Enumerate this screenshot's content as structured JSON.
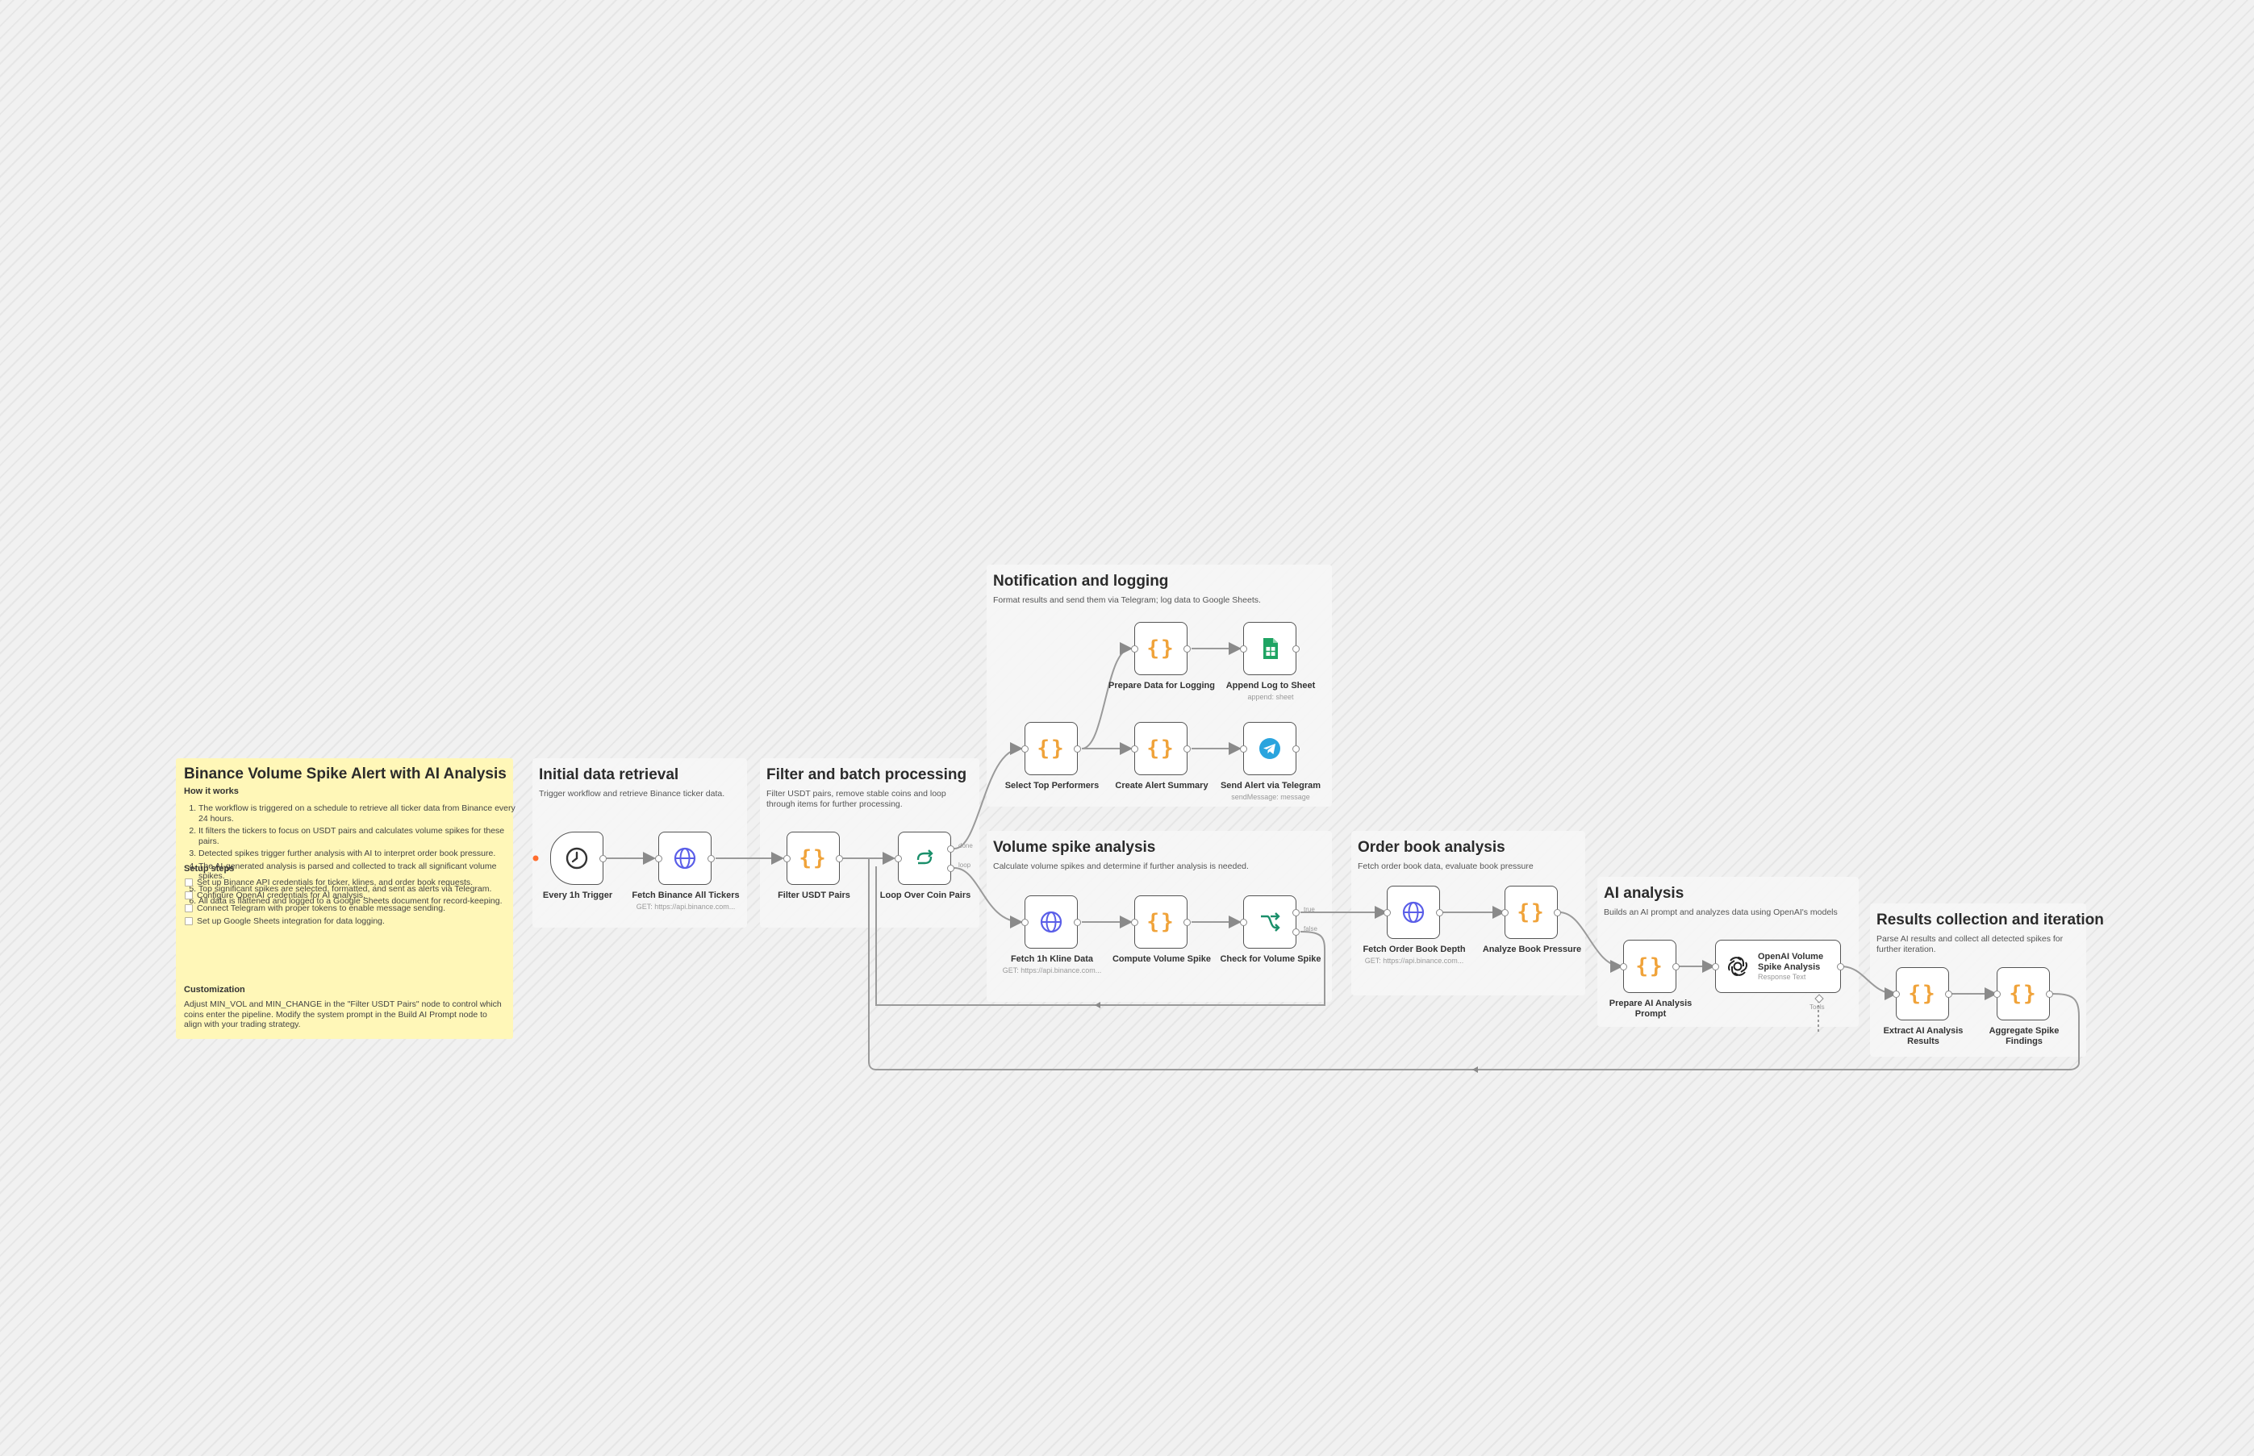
{
  "overview": {
    "title": "Binance Volume Spike Alert with AI Analysis",
    "how_heading": "How it works",
    "steps": [
      "The workflow is triggered on a schedule to retrieve all ticker data from Binance every 24 hours.",
      "It filters the tickers to focus on USDT pairs and calculates volume spikes for these pairs.",
      "Detected spikes trigger further analysis with AI to interpret order book pressure.",
      "The AI-generated analysis is parsed and collected to track all significant volume spikes.",
      "Top significant spikes are selected, formatted, and sent as alerts via Telegram.",
      "All data is flattened and logged to a Google Sheets document for record-keeping."
    ],
    "setup_heading": "Setup steps",
    "setup_steps": [
      "Set up Binance API credentials for ticker, klines, and order book requests.",
      "Configure OpenAI credentials for AI analysis.",
      "Connect Telegram with proper tokens to enable message sending.",
      "Set up Google Sheets integration for data logging."
    ],
    "custom_heading": "Customization",
    "custom_text": "Adjust MIN_VOL and MIN_CHANGE in the \"Filter USDT Pairs\" node to control which coins enter the pipeline. Modify the system prompt in the Build AI Prompt node to align with your trading strategy."
  },
  "sections": {
    "initial": {
      "title": "Initial data retrieval",
      "desc": "Trigger workflow and retrieve Binance ticker data."
    },
    "filter": {
      "title": "Filter and batch processing",
      "desc": "Filter USDT pairs, remove stable coins and loop through items for further processing."
    },
    "notify": {
      "title": "Notification and logging",
      "desc": "Format results and send them via Telegram; log data to Google Sheets."
    },
    "volume": {
      "title": "Volume spike analysis",
      "desc": "Calculate volume spikes and determine if further analysis is needed."
    },
    "orderbook": {
      "title": "Order book analysis",
      "desc": "Fetch order book data, evaluate book pressure"
    },
    "ai": {
      "title": "AI analysis",
      "desc": "Builds an AI prompt and analyzes data using OpenAI's models"
    },
    "results": {
      "title": "Results collection and iteration",
      "desc": "Parse AI results and collect all detected spikes for further iteration."
    }
  },
  "nodes": {
    "trigger": {
      "label": "Every 1h Trigger",
      "icon": "clock-icon"
    },
    "fetch_tickers": {
      "label": "Fetch Binance All Tickers",
      "sub": "GET: https://api.binance.com...",
      "icon": "globe-icon"
    },
    "filter_usdt": {
      "label": "Filter USDT Pairs",
      "icon": "code-icon"
    },
    "loop": {
      "label": "Loop Over Coin Pairs",
      "icon": "loop-icon"
    },
    "select_top": {
      "label": "Select Top Performers",
      "icon": "code-icon"
    },
    "prepare_log": {
      "label": "Prepare Data for Logging",
      "icon": "code-icon"
    },
    "append_log": {
      "label": "Append Log to Sheet",
      "sub": "append: sheet",
      "icon": "sheets-icon"
    },
    "alert_summary": {
      "label": "Create Alert Summary",
      "icon": "code-icon"
    },
    "send_telegram": {
      "label": "Send Alert via Telegram",
      "sub": "sendMessage: message",
      "icon": "telegram-icon"
    },
    "fetch_kline": {
      "label": "Fetch 1h Kline Data",
      "sub": "GET: https://api.binance.com...",
      "icon": "globe-icon"
    },
    "compute_spike": {
      "label": "Compute Volume Spike",
      "icon": "code-icon"
    },
    "check_spike": {
      "label": "Check for Volume Spike",
      "icon": "switch-icon"
    },
    "fetch_depth": {
      "label": "Fetch Order Book Depth",
      "sub": "GET: https://api.binance.com...",
      "icon": "globe-icon"
    },
    "book_pressure": {
      "label": "Analyze Book Pressure",
      "icon": "code-icon"
    },
    "prepare_prompt": {
      "label": "Prepare AI Analysis Prompt",
      "icon": "code-icon"
    },
    "openai": {
      "label": "OpenAI Volume Spike Analysis",
      "sub": "Response Text",
      "icon": "openai-icon"
    },
    "extract": {
      "label": "Extract AI Analysis Results",
      "icon": "code-icon"
    },
    "aggregate": {
      "label": "Aggregate Spike Findings",
      "icon": "code-icon"
    }
  },
  "port_labels": {
    "loop_done": "done",
    "loop_loop": "loop",
    "check_true": "true",
    "check_false": "false",
    "openai_tools": "Tools"
  },
  "colors": {
    "code": "#f0a33a",
    "globe": "#5a5ee8",
    "loop": "#1a8f6a",
    "switch": "#1a8f6a",
    "sheets": "#1fa463",
    "telegram": "#2aa4de",
    "trigger_dot": "#ff6d2e",
    "overview_bg": "#fff7b8"
  }
}
